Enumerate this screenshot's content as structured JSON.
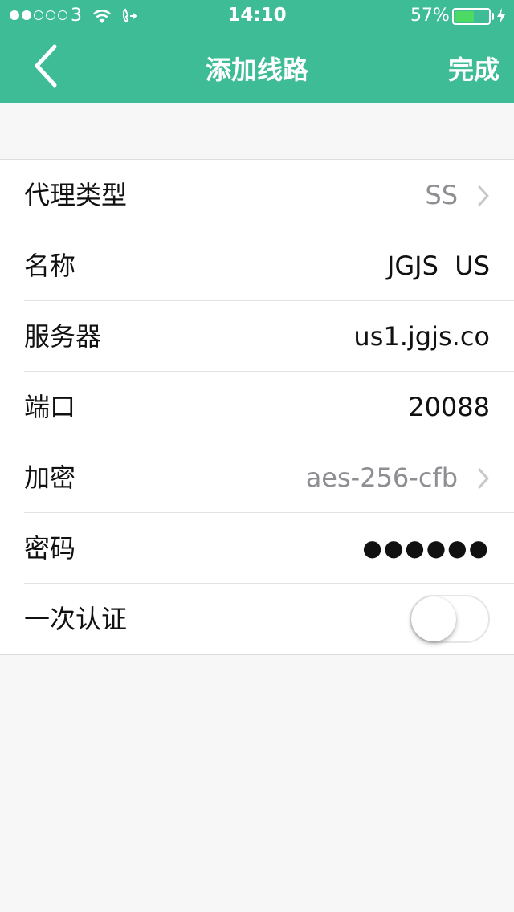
{
  "status_bar": {
    "carrier": "3",
    "time": "14:10",
    "battery_percent": "57%",
    "battery_level": 0.57,
    "signal_strength": 2,
    "signal_total": 5
  },
  "nav": {
    "title": "添加线路",
    "done_label": "完成",
    "back_icon": "chevron-left-icon"
  },
  "colors": {
    "accent": "#3dbc96",
    "battery_fill": "#4cd964"
  },
  "form": {
    "proxy_type": {
      "label": "代理类型",
      "value": "SS"
    },
    "name": {
      "label": "名称",
      "value": "JGJS  US"
    },
    "server": {
      "label": "服务器",
      "value": "us1.jgjs.co"
    },
    "port": {
      "label": "端口",
      "value": "20088"
    },
    "encryption": {
      "label": "加密",
      "value": "aes-256-cfb"
    },
    "password": {
      "label": "密码",
      "value": "●●●●●●"
    },
    "one_time_auth": {
      "label": "一次认证",
      "enabled": false
    }
  }
}
